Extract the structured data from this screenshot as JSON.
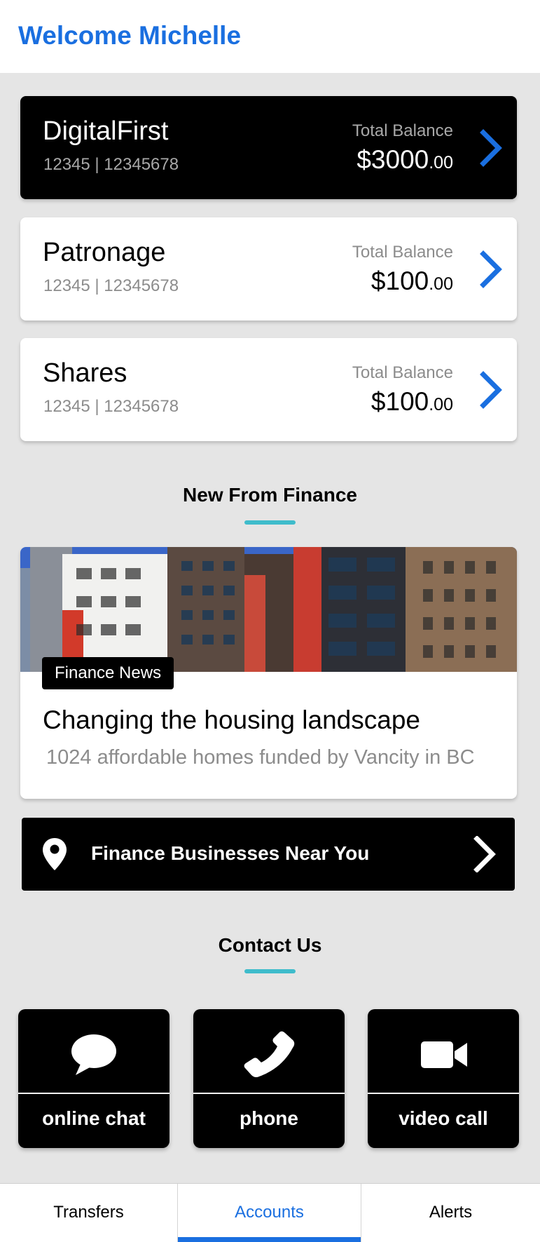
{
  "header": {
    "welcome": "Welcome Michelle"
  },
  "accounts": [
    {
      "name": "DigitalFirst",
      "number": "12345 | 12345678",
      "balance_label": "Total Balance",
      "balance_main": "$3000",
      "balance_cents": ".00",
      "theme": "dark"
    },
    {
      "name": "Patronage",
      "number": "12345 | 12345678",
      "balance_label": "Total Balance",
      "balance_main": "$100",
      "balance_cents": ".00",
      "theme": "light"
    },
    {
      "name": "Shares",
      "number": "12345 | 12345678",
      "balance_label": "Total Balance",
      "balance_main": "$100",
      "balance_cents": ".00",
      "theme": "light"
    }
  ],
  "news_section": {
    "title": "New From Finance",
    "card": {
      "tag": "Finance News",
      "title": "Changing the housing landscape",
      "subtitle": "1024 affordable homes funded by Vancity in BC"
    }
  },
  "finder": {
    "label": "Finance Businesses Near You"
  },
  "contact": {
    "title": "Contact Us",
    "buttons": [
      {
        "label": "online chat",
        "icon": "chat-bubble-icon"
      },
      {
        "label": "phone",
        "icon": "phone-icon"
      },
      {
        "label": "video call",
        "icon": "video-camera-icon"
      }
    ]
  },
  "tabbar": {
    "tabs": [
      {
        "label": "Transfers",
        "active": false
      },
      {
        "label": "Accounts",
        "active": true
      },
      {
        "label": "Alerts",
        "active": false
      }
    ]
  },
  "colors": {
    "accent_blue": "#1a6fe0",
    "underline_teal": "#3fbccb",
    "background": "#e5e5e5",
    "card_dark": "#000000",
    "card_light": "#ffffff"
  }
}
